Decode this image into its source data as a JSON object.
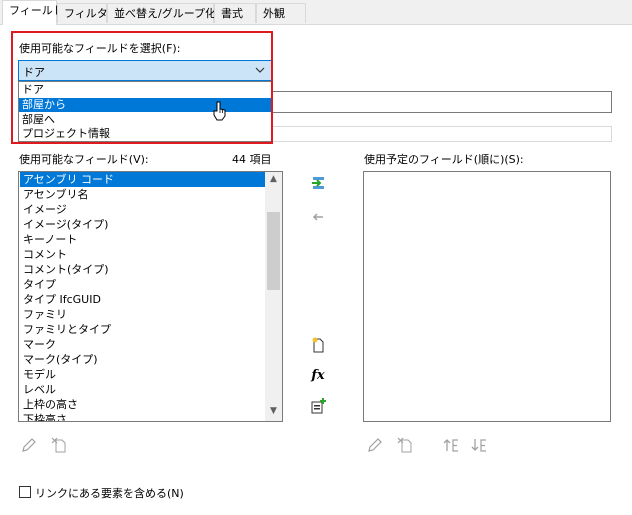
{
  "tabs": [
    {
      "label": "フィールド",
      "active": true
    },
    {
      "label": "フィルタ"
    },
    {
      "label": "並べ替え/グループ化"
    },
    {
      "label": "書式"
    },
    {
      "label": "外観"
    }
  ],
  "selector": {
    "label": "使用可能なフィールドを選択(F):",
    "value": "ドア",
    "options": [
      "ドア",
      "部屋から",
      "部屋へ",
      "プロジェクト情報"
    ],
    "highlighted": "部屋から"
  },
  "available": {
    "label": "使用可能なフィールド(V):",
    "count": "44 項目",
    "items": [
      "アセンブリ コード",
      "アセンブリ名",
      "イメージ",
      "イメージ(タイプ)",
      "キーノート",
      "コメント",
      "コメント(タイプ)",
      "タイプ",
      "タイプ IfcGUID",
      "ファミリ",
      "ファミリとタイプ",
      "マーク",
      "マーク(タイプ)",
      "モデル",
      "レベル",
      "上枠の高さ",
      "下枠高さ"
    ],
    "selected": "アセンブリ コード"
  },
  "scheduled": {
    "label": "使用予定のフィールド(順に)(S):"
  },
  "footer": {
    "include_links_label": "リンクにある要素を含める(N)"
  },
  "colors": {
    "accent": "#0078d7",
    "highlight_frame": "#e0191f",
    "selected_box": "#cce4f7"
  }
}
